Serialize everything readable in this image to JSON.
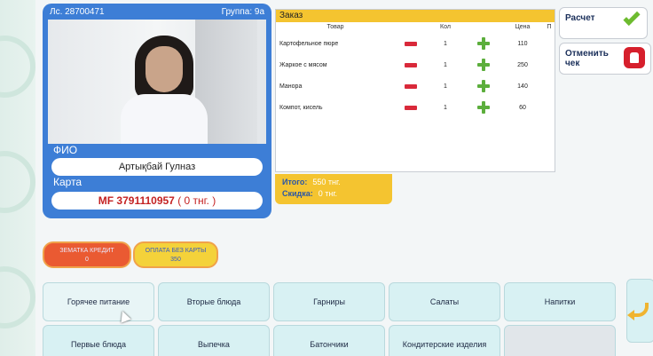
{
  "student": {
    "account": "Лс. 28700471",
    "group": "Группа: 9а",
    "fio_label": "ФИО",
    "fio": "Артықбай Гулназ",
    "card_label": "Карта",
    "card_number": "MF 3791110957",
    "card_balance": "( 0 тнг. )"
  },
  "order": {
    "title": "Заказ",
    "columns": [
      "Товар",
      "Кол",
      "Цена",
      "П"
    ],
    "rows": [
      {
        "name": "Картофельное пюре",
        "qty": "1",
        "price": "110"
      },
      {
        "name": "Жаркое с мясом",
        "qty": "1",
        "price": "250"
      },
      {
        "name": "Манора",
        "qty": "1",
        "price": "140"
      },
      {
        "name": "Компот, кисель",
        "qty": "1",
        "price": "60"
      }
    ],
    "total_label": "Итого:",
    "total_value": "550 тнг.",
    "discount_label": "Скидка:",
    "discount_value": "0 тнг."
  },
  "actions": {
    "pay_label": "Расчет",
    "cancel_label": "Отменить чек"
  },
  "modes": {
    "red_line1": "ЗЕМАТКА КРЕДИТ",
    "red_line2": "0",
    "yellow_line1": "ОПЛАТА БЕЗ КАРТЫ",
    "yellow_line2": "350"
  },
  "categories": [
    "Горячее питание",
    "Вторые блюда",
    "Гарниры",
    "Салаты",
    "Напитки",
    "Первые блюда",
    "Выпечка",
    "Батончики",
    "Кондитерские изделия",
    ""
  ],
  "colors": {
    "accent_blue": "#3d7ed6",
    "order_yellow": "#f4c430",
    "plus_green": "#5cae3c",
    "minus_red": "#d9293a"
  }
}
